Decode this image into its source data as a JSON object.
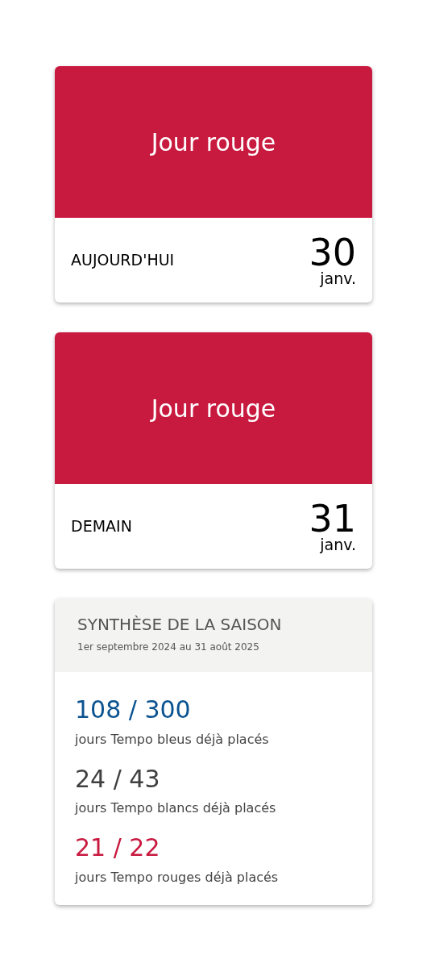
{
  "days": [
    {
      "status": "Jour rouge",
      "color": "#c8193f",
      "label": "AUJOURD'HUI",
      "day": "30",
      "month": "janv."
    },
    {
      "status": "Jour rouge",
      "color": "#c8193f",
      "label": "DEMAIN",
      "day": "31",
      "month": "janv."
    }
  ],
  "season": {
    "title": "SYNTHÈSE DE LA SAISON",
    "period": "1er septembre 2024 au 31 août 2025",
    "stats": [
      {
        "count": "108 / 300",
        "color": "#0b5390",
        "caption": "jours Tempo bleus déjà placés"
      },
      {
        "count": "24 / 43",
        "color": "#404040",
        "caption": "jours Tempo blancs déjà placés"
      },
      {
        "count": "21 / 22",
        "color": "#c8193f",
        "caption": "jours Tempo rouges déjà placés"
      }
    ]
  }
}
